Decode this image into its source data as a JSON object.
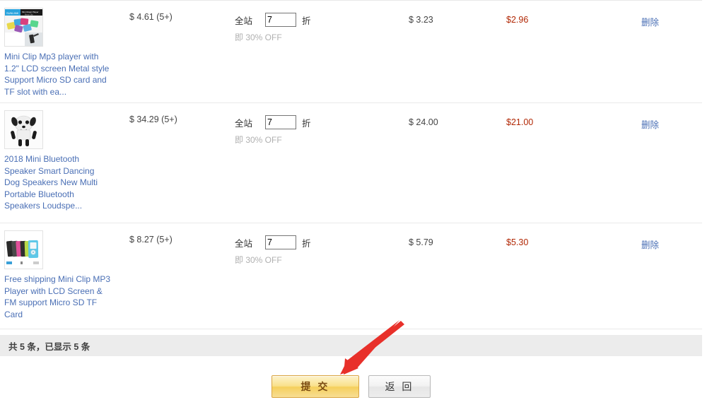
{
  "table": {
    "rows": [
      {
        "thumb_icon": "mp3-player-collage-thumbnail",
        "title": "Mini Clip Mp3 player with 1.2\" LCD screen Metal style Support Micro SD card and TF slot with ea...",
        "base_price": "$ 4.61 (5+)",
        "discount_label": "全站",
        "discount_value": "7",
        "discount_suffix": "折",
        "discount_note": "即 30% OFF",
        "new_price": "$ 3.23",
        "final_price": "$2.96",
        "delete_label": "删除"
      },
      {
        "thumb_icon": "dancing-dog-speaker-thumbnail",
        "title": "2018 Mini Bluetooth Speaker Smart Dancing Dog Speakers New Multi Portable Bluetooth Speakers Loudspe...",
        "base_price": "$ 34.29 (5+)",
        "discount_label": "全站",
        "discount_value": "7",
        "discount_suffix": "折",
        "discount_note": "即 30% OFF",
        "new_price": "$ 24.00",
        "final_price": "$21.00",
        "delete_label": "删除"
      },
      {
        "thumb_icon": "mp3-player-row-thumbnail",
        "title": "Free shipping Mini Clip MP3 Player with LCD Screen & FM support Micro SD TF Card",
        "base_price": "$ 8.27 (5+)",
        "discount_label": "全站",
        "discount_value": "7",
        "discount_suffix": "折",
        "discount_note": "即 30% OFF",
        "new_price": "$ 5.79",
        "final_price": "$5.30",
        "delete_label": "删除"
      }
    ]
  },
  "summary": {
    "text": "共 5 条，已显示 5 条"
  },
  "actions": {
    "submit_label": "提 交",
    "return_label": "返 回"
  },
  "annotation": {
    "arrow_icon": "red-pointer-arrow",
    "arrow_color": "#e8302a",
    "points_at": "submit-button"
  },
  "colors": {
    "link": "#4a6fb5",
    "final_price": "#b12704",
    "summary_bar": "#ececec",
    "submit_button": "#f5cf5c",
    "row_divider": "#eaeaea"
  }
}
